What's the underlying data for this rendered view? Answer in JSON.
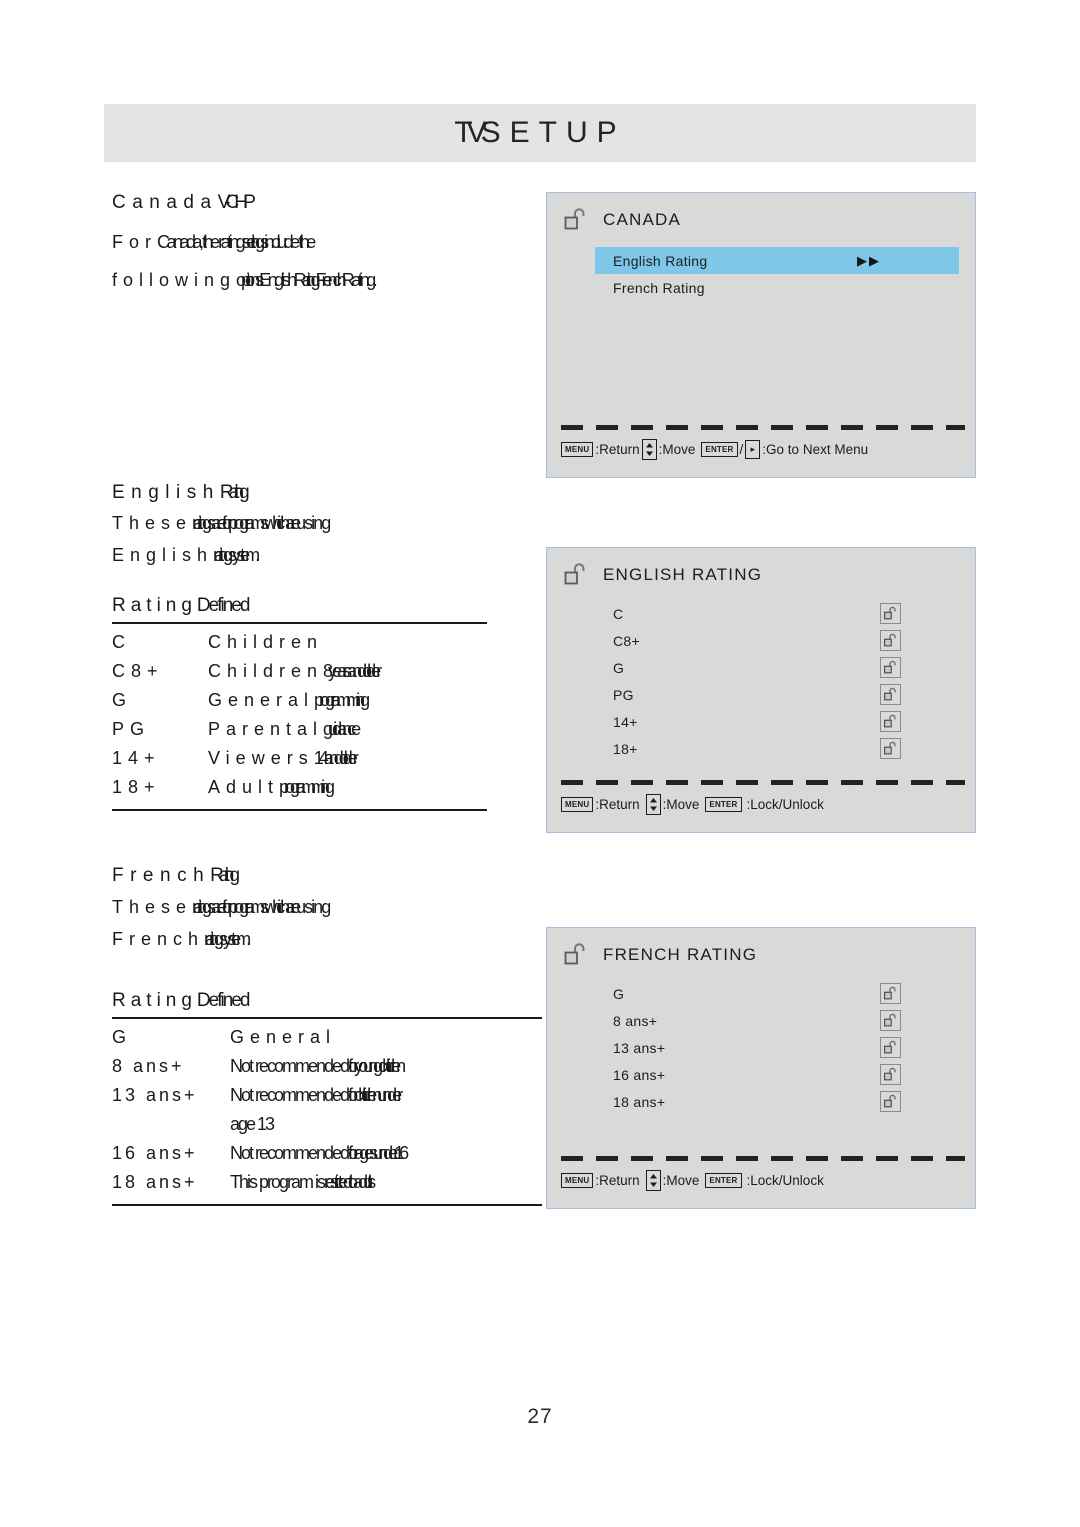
{
  "page": {
    "header_title_part1": "TV",
    "header_title_part2": "SETUP",
    "number": "27"
  },
  "sections": {
    "canada": {
      "heading_a": "Canada",
      "heading_b": "V-CHIP",
      "para_line1_a": "For",
      "para_line1_b": "Canada, the rating",
      "para_line1_c": "settings",
      "para_line1_d": "include the",
      "para_line2_a": "following",
      "para_line2_b": "options:",
      "para_line2_c": "English",
      "para_line2_d": "Rating, French",
      "para_line2_e": "Rating."
    },
    "english": {
      "heading_a": "English",
      "heading_b": "Rating",
      "para_line1_a": "These",
      "para_line1_b": "ratings are",
      "para_line1_c": "for programs",
      "para_line1_d": "which are",
      "para_line1_e": "using",
      "para_line2_a": "English",
      "para_line2_b": "rating",
      "para_line2_c": "system."
    },
    "french": {
      "heading_a": "French",
      "heading_b": "Rating",
      "para_line1_a": "These",
      "para_line1_b": "ratings are",
      "para_line1_c": "for programs",
      "para_line1_d": "which are",
      "para_line1_e": "using",
      "para_line2_a": "French",
      "para_line2_b": "rating",
      "para_line2_c": "system."
    }
  },
  "english_table": {
    "title_a": "Rating",
    "title_b": "Defined",
    "rows": [
      {
        "code": "C",
        "desc_a": "Children",
        "desc_b": "",
        "desc_c": ""
      },
      {
        "code": "C8+",
        "desc_a": "Children",
        "desc_b": "8 years and",
        "desc_c": "older"
      },
      {
        "code": "G",
        "desc_a": "General",
        "desc_b": "programming",
        "desc_c": ""
      },
      {
        "code": "PG",
        "desc_a": "Parental",
        "desc_b": "guidance",
        "desc_c": ""
      },
      {
        "code": "14+",
        "desc_a": "Viewers",
        "desc_b": "14 and",
        "desc_c": "older"
      },
      {
        "code": "18+",
        "desc_a": "Adult",
        "desc_b": "programming",
        "desc_c": ""
      }
    ]
  },
  "french_table": {
    "title_a": "Rating",
    "title_b": "Defined",
    "rows": [
      {
        "code": "G",
        "desc_a": "General",
        "desc_b": "",
        "desc_c": ""
      },
      {
        "code": "8 ans+",
        "desc_a": "Not recommended",
        "desc_b": "for young",
        "desc_c": "children"
      },
      {
        "code": "13 ans+",
        "desc_a": "Not recommended",
        "desc_b": "for children",
        "desc_c": "under"
      },
      {
        "code": "16 ans+",
        "desc_a": "Not recommended",
        "desc_b": "for ages under",
        "desc_c": "16"
      },
      {
        "code": "18 ans+",
        "desc_a": "This program is",
        "desc_b": "restricted to",
        "desc_c": "adults"
      }
    ],
    "row_13_continuation": "age 13"
  },
  "osd": {
    "canada": {
      "title": "CANADA",
      "rows": [
        {
          "label": "English Rating",
          "selected": true,
          "arrows": "▶▶"
        },
        {
          "label": "French Rating",
          "selected": false,
          "arrows": ""
        }
      ],
      "hint": {
        "key_menu": "MENU",
        "txt_return": ":Return",
        "txt_move": ":Move",
        "key_enter": "ENTER",
        "txt_slash": "/",
        "arrow_right": "▸",
        "txt_next": ":Go to Next Menu"
      }
    },
    "english": {
      "title": "ENGLISH RATING",
      "rows": [
        {
          "label": "C"
        },
        {
          "label": "C8+"
        },
        {
          "label": "G"
        },
        {
          "label": "PG"
        },
        {
          "label": "14+"
        },
        {
          "label": "18+"
        }
      ],
      "hint": {
        "key_menu": "MENU",
        "txt_return": ":Return",
        "txt_move": ":Move",
        "key_enter": "ENTER",
        "txt_lock": ":Lock/Unlock"
      }
    },
    "french": {
      "title": "FRENCH RATING",
      "rows": [
        {
          "label": "G"
        },
        {
          "label": "8 ans+"
        },
        {
          "label": "13 ans+"
        },
        {
          "label": "16 ans+"
        },
        {
          "label": "18 ans+"
        }
      ],
      "hint": {
        "key_menu": "MENU",
        "txt_return": ":Return",
        "txt_move": ":Move",
        "key_enter": "ENTER",
        "txt_lock": ":Lock/Unlock"
      }
    }
  },
  "colors": {
    "header_band": "#e4e4e4",
    "osd_background": "#d9d9d9",
    "osd_border": "#a8c0de",
    "highlight": "#7fc7e8",
    "text": "#1a1a1a"
  }
}
